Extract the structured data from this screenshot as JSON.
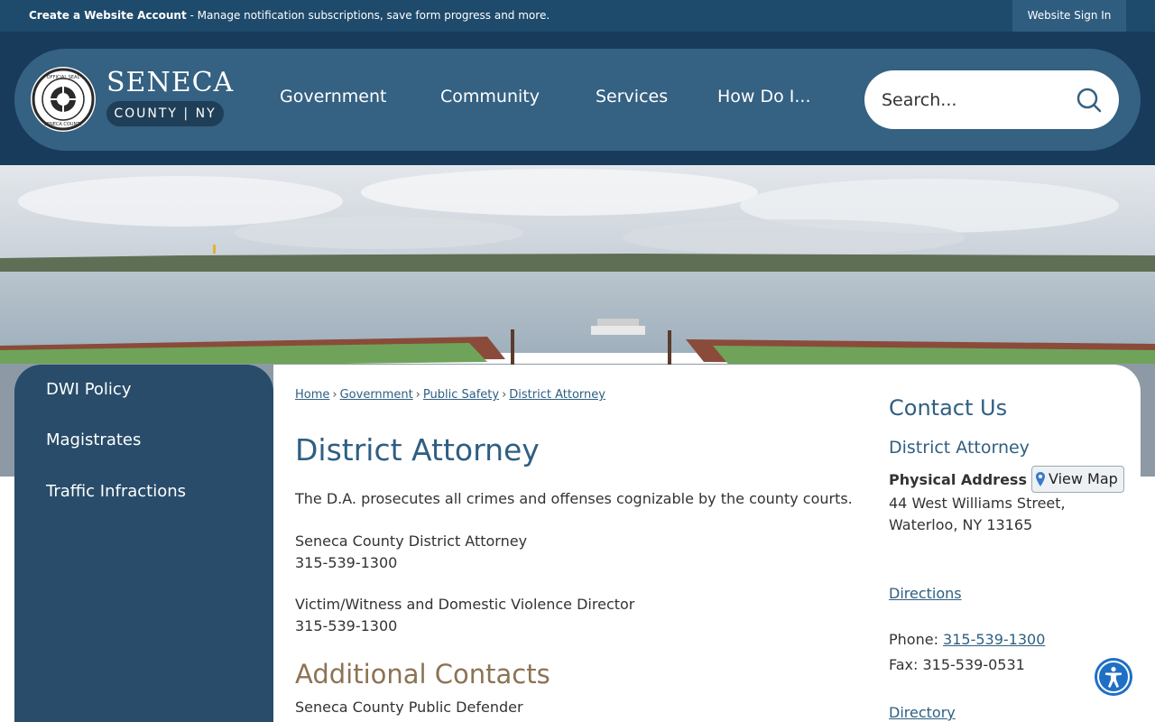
{
  "topbar": {
    "create_account": "Create a Website Account",
    "create_account_desc": " - Manage notification subscriptions, save form progress and more.",
    "sign_in": "Website Sign In"
  },
  "brand": {
    "title": "SENECA",
    "subtitle": "COUNTY | NY",
    "seal_text": "OFFICIAL SEAL SENECA COUNTY"
  },
  "nav": {
    "items": [
      "Government",
      "Community",
      "Services",
      "How Do I..."
    ]
  },
  "search": {
    "placeholder": "Search..."
  },
  "sidebar": {
    "items": [
      "DWI Policy",
      "Magistrates",
      "Traffic Infractions"
    ]
  },
  "breadcrumb": {
    "items": [
      "Home",
      "Government",
      "Public Safety",
      "District Attorney"
    ],
    "separator": "›"
  },
  "main": {
    "title": "District Attorney",
    "intro": "The D.A. prosecutes all crimes and offenses cognizable by the county courts.",
    "contact1_name": "Seneca County District Attorney",
    "contact1_phone": "315-539-1300",
    "contact2_name": "Victim/Witness and Domestic Violence Director",
    "contact2_phone": "315-539-1300",
    "additional_title": "Additional Contacts",
    "additional1_name": "Seneca County Public Defender"
  },
  "contact": {
    "title": "Contact Us",
    "name": "District Attorney",
    "physical_label": "Physical Address",
    "view_map": "View Map",
    "address_line1": "44 West Williams Street,",
    "address_line2": "Waterloo, NY 13165",
    "directions": "Directions",
    "phone_label": "Phone: ",
    "phone": "315-539-1300",
    "fax": "Fax: 315-539-0531",
    "directory": "Directory"
  },
  "colors": {
    "header_dark": "#183b5c",
    "header_pill": "#356182",
    "sidebar": "#284c6a",
    "title_blue": "#2f5f82",
    "subtitle_tan": "#8c7353",
    "accessibility": "#1f6fc5"
  }
}
